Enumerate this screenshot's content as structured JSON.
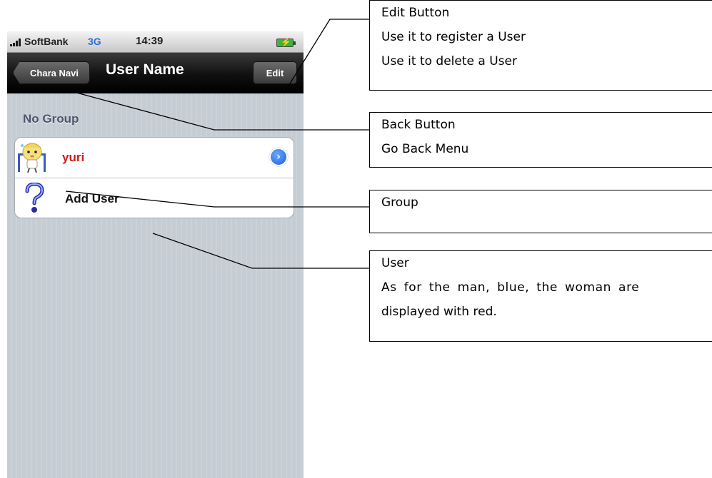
{
  "status_bar": {
    "carrier": "SoftBank",
    "network": "3G",
    "time": "14:39"
  },
  "nav_bar": {
    "back_label": "Chara Navi",
    "title": "User Name",
    "edit_label": "Edit"
  },
  "group": {
    "header": "No Group",
    "rows": [
      {
        "name": "yuri",
        "name_color": "#cc1a1a",
        "icon": "character-avatar-icon",
        "accessory": "disclosure-chevron-icon"
      },
      {
        "name": "Add User",
        "icon": "question-mark-icon"
      }
    ]
  },
  "callouts": [
    {
      "lines": [
        "Edit Button",
        "Use it to register a User",
        "Use it to delete a User"
      ]
    },
    {
      "lines": [
        "Back Button",
        "Go Back Menu"
      ]
    },
    {
      "lines": [
        "Group"
      ]
    },
    {
      "lines": [
        "User",
        "As for the man, blue, the woman are",
        "displayed with red."
      ]
    }
  ],
  "colors": {
    "nav_bar": "#000000",
    "table_background": "#c5ccd4",
    "female_user": "#cc1a1a",
    "male_user": "#2a6fd8"
  }
}
